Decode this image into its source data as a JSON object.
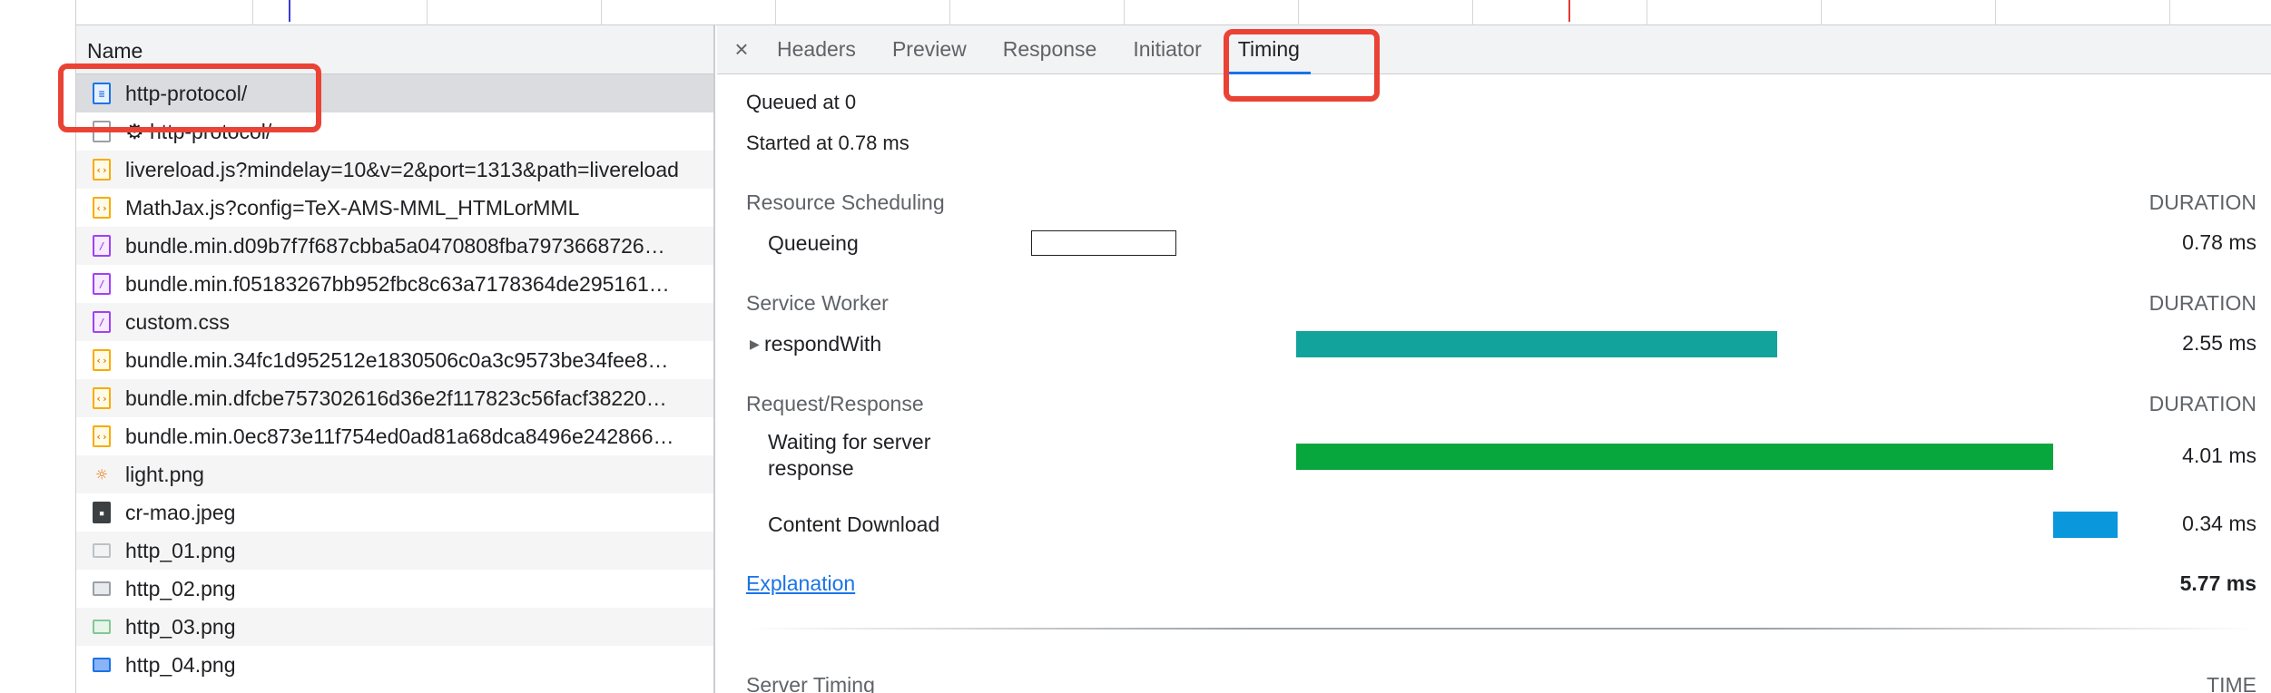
{
  "list": {
    "header": "Name",
    "rows": [
      {
        "name": "http-protocol/",
        "icon": "document-icon"
      },
      {
        "name": "⚙ http-protocol/",
        "icon": "blank-file-icon"
      },
      {
        "name": "livereload.js?mindelay=10&v=2&port=1313&path=livereload",
        "icon": "script-icon"
      },
      {
        "name": "MathJax.js?config=TeX-AMS-MML_HTMLorMML",
        "icon": "script-icon"
      },
      {
        "name": "bundle.min.d09b7f7f687cbba5a0470808fba7973668726…",
        "icon": "stylesheet-icon"
      },
      {
        "name": "bundle.min.f05183267bb952fbc8c63a7178364de295161…",
        "icon": "stylesheet-icon"
      },
      {
        "name": "custom.css",
        "icon": "stylesheet-icon"
      },
      {
        "name": "bundle.min.34fc1d952512e1830506c0a3c9573be34fee8…",
        "icon": "script-icon"
      },
      {
        "name": "bundle.min.dfcbe757302616d36e2f117823c56facf38220…",
        "icon": "script-icon"
      },
      {
        "name": "bundle.min.0ec873e11f754ed0ad81a68dca8496e242866…",
        "icon": "script-icon"
      },
      {
        "name": "light.png",
        "icon": "sun-image-icon"
      },
      {
        "name": "cr-mao.jpeg",
        "icon": "image-icon"
      },
      {
        "name": "http_01.png",
        "icon": "image-icon"
      },
      {
        "name": "http_02.png",
        "icon": "image-icon"
      },
      {
        "name": "http_03.png",
        "icon": "image-icon"
      },
      {
        "name": "http_04.png",
        "icon": "image-icon"
      }
    ]
  },
  "tabs": {
    "close": "×",
    "items": [
      "Headers",
      "Preview",
      "Response",
      "Initiator",
      "Timing"
    ],
    "active": "Timing"
  },
  "timing": {
    "queued": "Queued at 0",
    "started": "Started at 0.78 ms",
    "sections": [
      {
        "title": "Resource Scheduling",
        "duration_head": "DURATION",
        "items": [
          {
            "label": "Queueing",
            "value": "0.78 ms",
            "start_ms": 0,
            "dur_ms": 0.78,
            "color": "#ffffff"
          }
        ]
      },
      {
        "title": "Service Worker",
        "duration_head": "DURATION",
        "items": [
          {
            "label": "respondWith",
            "value": "2.55 ms",
            "start_ms": 0.78,
            "dur_ms": 2.55,
            "color": "#12a39c"
          }
        ]
      },
      {
        "title": "Request/Response",
        "duration_head": "DURATION",
        "items": [
          {
            "label": "Waiting for server response",
            "value": "4.01 ms",
            "start_ms": 0.78,
            "dur_ms": 4.01,
            "color": "#07a73e"
          },
          {
            "label": "Content Download",
            "value": "0.34 ms",
            "start_ms": 4.79,
            "dur_ms": 0.34,
            "color": "#0a97dc"
          }
        ]
      }
    ],
    "explanation": "Explanation",
    "total": "5.77 ms",
    "server_timing": {
      "title": "Server Timing",
      "head": "TIME"
    }
  }
}
